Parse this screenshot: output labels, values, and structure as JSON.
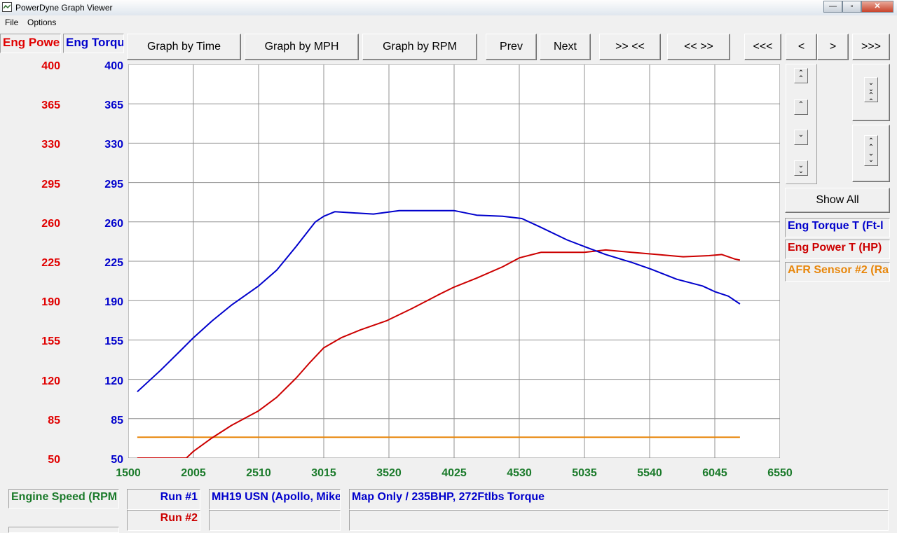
{
  "window": {
    "title": "PowerDyne Graph Viewer",
    "controls": {
      "minimize": "—",
      "maximize": "▫",
      "close": "✕"
    }
  },
  "menu": {
    "items": [
      "File",
      "Options"
    ]
  },
  "channel_labels": {
    "left": "Eng Powe",
    "right": "Eng Torqu"
  },
  "toolbar": {
    "graph_by_time": "Graph by Time",
    "graph_by_mph": "Graph by MPH",
    "graph_by_rpm": "Graph by RPM",
    "prev": "Prev",
    "next": "Next",
    "zoom_in": ">> <<",
    "zoom_out": "<< >>",
    "first": "<<<",
    "back": "<",
    "forward": ">",
    "last": ">>>"
  },
  "side": {
    "show_all": "Show All",
    "legend": [
      {
        "name": "Eng Torque T (Ft-l",
        "color": "#0000cc"
      },
      {
        "name": "Eng Power T (HP)",
        "color": "#cc0000"
      },
      {
        "name": "AFR Sensor #2 (Ra",
        "color": "#e8870c"
      }
    ],
    "icons": {
      "scroll_top": "double-up-chevron-icon",
      "scroll_up": "up-chevron-icon",
      "scroll_down": "down-chevron-icon",
      "scroll_bottom": "double-down-chevron-icon",
      "zoom_shrink": "compress-vertical-icon",
      "zoom_expand": "expand-vertical-icon"
    }
  },
  "bottom": {
    "x_channel": "Engine Speed (RPM",
    "run1_label": "Run #1",
    "run1_vehicle": "MH19 USN (Apollo, Mike",
    "run1_desc": "Map Only / 235BHP, 272Ftlbs Torque",
    "run2_label": "Run #2",
    "run2_vehicle": "",
    "run2_desc": ""
  },
  "chart_data": {
    "type": "line",
    "x_ticks": [
      "1500",
      "2005",
      "2510",
      "3015",
      "3520",
      "4025",
      "4530",
      "5035",
      "5540",
      "6045",
      "6550"
    ],
    "xlim": [
      1500,
      6550
    ],
    "y_left_ticks": [
      "400",
      "365",
      "330",
      "295",
      "260",
      "225",
      "190",
      "155",
      "120",
      "85",
      "50"
    ],
    "y_right_ticks": [
      "400",
      "365",
      "330",
      "295",
      "260",
      "225",
      "190",
      "155",
      "120",
      "85",
      "50"
    ],
    "ylim": [
      50,
      400
    ],
    "grid": true,
    "series": [
      {
        "name": "Eng Torque T (Ft-l",
        "color": "#0000cc",
        "x": [
          1570,
          1750,
          1900,
          2005,
          2150,
          2300,
          2510,
          2650,
          2800,
          2950,
          3015,
          3100,
          3250,
          3400,
          3600,
          3800,
          4025,
          4200,
          4400,
          4550,
          4700,
          4900,
          5035,
          5200,
          5400,
          5550,
          5750,
          5950,
          6045,
          6150,
          6240
        ],
        "values": [
          109,
          128,
          145,
          157,
          172,
          186,
          203,
          217,
          238,
          260,
          265,
          269,
          268,
          267,
          270,
          270,
          270,
          266,
          265,
          263,
          255,
          244,
          238,
          231,
          224,
          218,
          209,
          203,
          198,
          194,
          187
        ]
      },
      {
        "name": "Eng Power T (HP)",
        "color": "#cc0000",
        "x": [
          1570,
          1950,
          2005,
          2150,
          2300,
          2510,
          2650,
          2800,
          2900,
          3015,
          3150,
          3300,
          3500,
          3700,
          3900,
          4025,
          4200,
          4400,
          4530,
          4700,
          4900,
          5035,
          5200,
          5400,
          5600,
          5800,
          6000,
          6100,
          6200,
          6240
        ],
        "values": [
          50,
          50,
          56,
          68,
          79,
          92,
          104,
          121,
          134,
          148,
          157,
          164,
          172,
          183,
          195,
          202,
          210,
          220,
          228,
          233,
          233,
          233,
          235,
          233,
          231,
          229,
          230,
          231,
          227,
          226
        ]
      },
      {
        "name": "AFR Sensor #2 (Ra",
        "color": "#e8870c",
        "x": [
          1570,
          1950,
          2005,
          6240
        ],
        "values": [
          68.5,
          68.6,
          68.5,
          68.5
        ]
      }
    ]
  }
}
